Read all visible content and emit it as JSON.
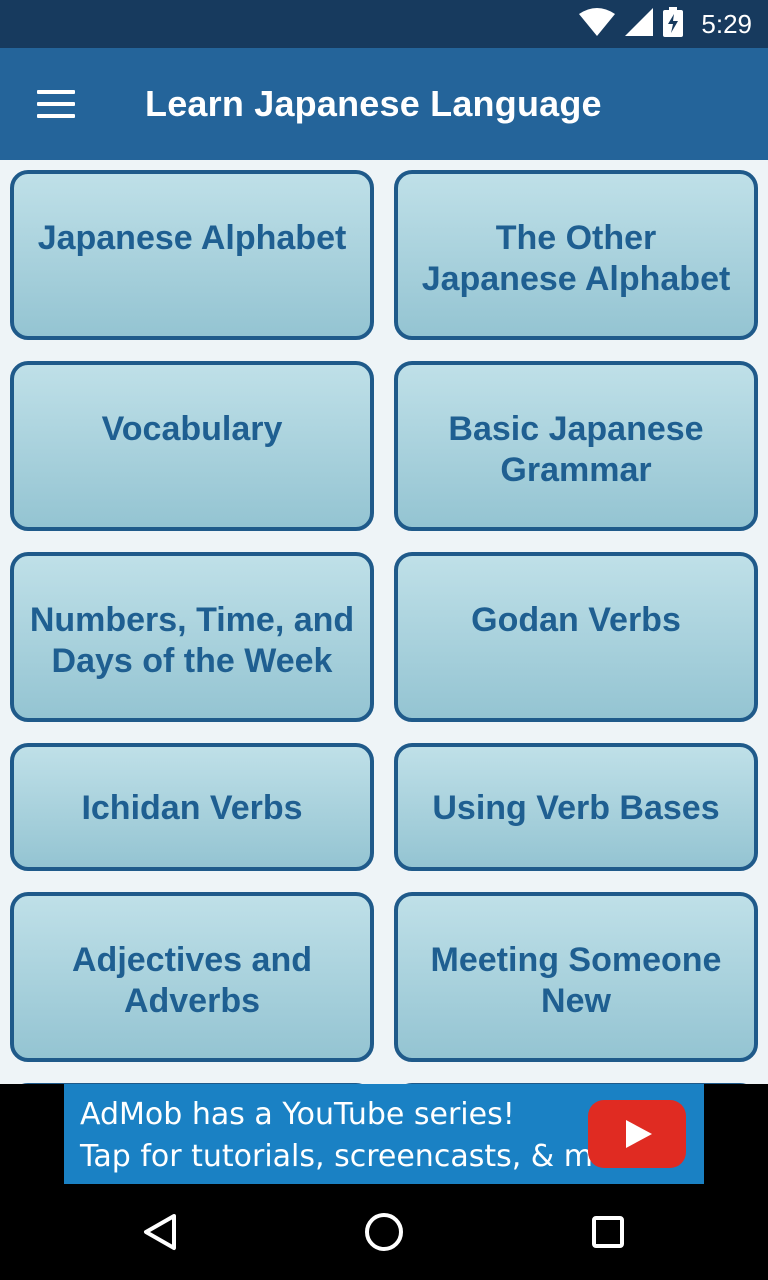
{
  "status_bar": {
    "time": "5:29"
  },
  "app_bar": {
    "title": "Learn Japanese Language"
  },
  "tiles": [
    {
      "label": "Japanese Alphabet"
    },
    {
      "label": "The Other\nJapanese Alphabet"
    },
    {
      "label": "Vocabulary"
    },
    {
      "label": "Basic Japanese\nGrammar"
    },
    {
      "label": "Numbers, Time, and\nDays of the Week"
    },
    {
      "label": "Godan Verbs"
    },
    {
      "label": "Ichidan Verbs"
    },
    {
      "label": "Using Verb Bases"
    },
    {
      "label": "Adjectives and\nAdverbs"
    },
    {
      "label": "Meeting Someone\nNew"
    }
  ],
  "ad": {
    "line1": "AdMob has a YouTube series!",
    "line2": "Tap for tutorials, screencasts, & more.",
    "icon": "youtube-play-icon"
  },
  "nav": {
    "back_icon": "back-triangle-icon",
    "home_icon": "home-circle-icon",
    "recents_icon": "recents-square-icon"
  }
}
